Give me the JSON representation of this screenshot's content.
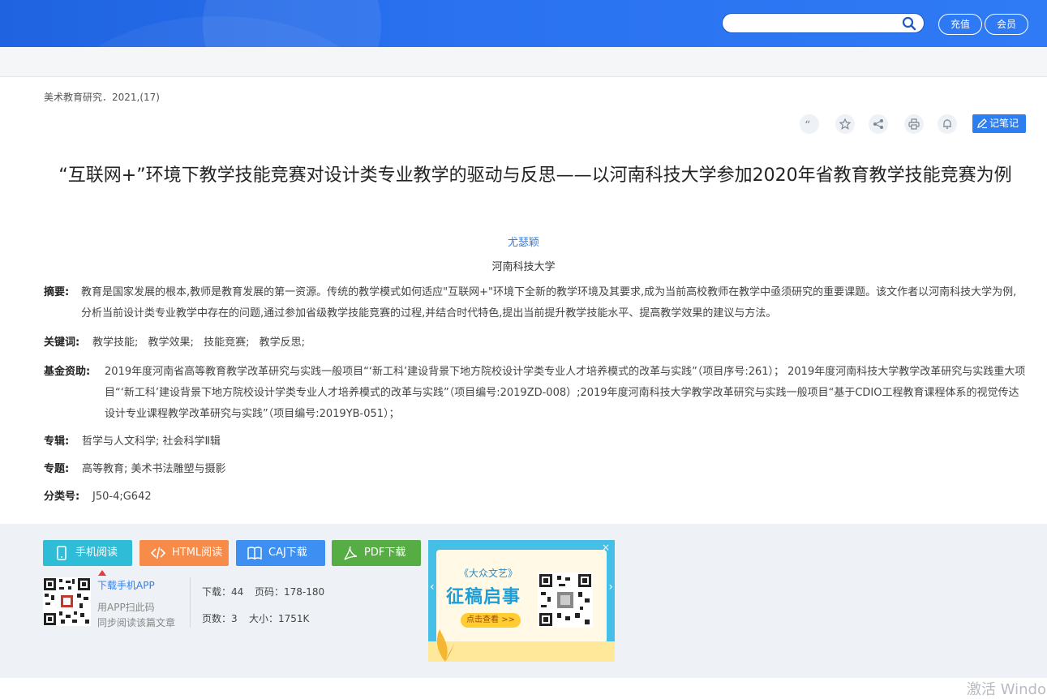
{
  "header": {
    "search_placeholder": "",
    "recharge_label": "充值",
    "member_label": "会员"
  },
  "article": {
    "source": "美术教育研究．2021,(17)",
    "note_label": "记笔记",
    "title": "“互联网+”环境下教学技能竞赛对设计类专业教学的驱动与反思——以河南科技大学参加2020年省教育教学技能竞赛为例",
    "author": "尤瑟颖",
    "organization": "河南科技大学",
    "abstract_label": "摘要:",
    "abstract": "教育是国家发展的根本,教师是教育发展的第一资源。传统的教学模式如何适应\"互联网+\"环境下全新的教学环境及其要求,成为当前高校教师在教学中亟须研究的重要课题。该文作者以河南科技大学为例,分析当前设计类专业教学中存在的问题,通过参加省级教学技能竞赛的过程,并结合时代特色,提出当前提升教学技能水平、提高教学效果的建议与方法。",
    "keywords_label": "关键词:",
    "keywords": [
      "教学技能;",
      "教学效果;",
      "技能竞赛;",
      "教学反思;"
    ],
    "fund_label": "基金资助:",
    "fund": "2019年度河南省高等教育教学改革研究与实践一般项目“‘新工科’建设背景下地方院校设计学类专业人才培养模式的改革与实践”（项目序号:261）； 2019年度河南科技大学教学改革研究与实践重大项目“‘新工科’建设背景下地方院校设计学类专业人才培养模式的改革与实践”（项目编号:2019ZD-008）;2019年度河南科技大学教学改革研究与实践一般项目“基于CDIO工程教育课程体系的视觉传达设计专业课程教学改革研究与实践”（项目编号:2019YB-051）；",
    "album_label": "专辑:",
    "album": "哲学与人文科学; 社会科学Ⅱ辑",
    "topic_label": "专题:",
    "topic": "高等教育; 美术书法雕塑与摄影",
    "classno_label": "分类号:",
    "classno": "J50-4;G642"
  },
  "tools": [
    {
      "icon": "quote-icon"
    },
    {
      "icon": "star-icon"
    },
    {
      "icon": "share-icon"
    },
    {
      "icon": "print-icon"
    },
    {
      "icon": "bell-icon"
    }
  ],
  "actions": {
    "mobile_read": "手机阅读",
    "html_read": "HTML阅读",
    "caj_download": "CAJ下载",
    "pdf_download": "PDF下载"
  },
  "app": {
    "link": "下载手机APP",
    "line1": "用APP扫此码",
    "line2": "同步阅读该篇文章"
  },
  "stats": {
    "downloads": "下载：44",
    "pages_range": "页码：178-180",
    "page_count": "页数：3",
    "size": "大小：1751K"
  },
  "ad": {
    "magazine": "《大众文艺》",
    "headline": "征稿启事",
    "check_label": "点击查看 >>",
    "close": "×"
  },
  "watermark": "激活 Windo",
  "colors": {
    "header_blue": "#2a72f0",
    "note_blue": "#2d7ff0",
    "mobile_btn": "#2ebcd6",
    "html_btn": "#f78b4a",
    "caj_btn": "#3d8ff2",
    "pdf_btn": "#55ad44"
  }
}
